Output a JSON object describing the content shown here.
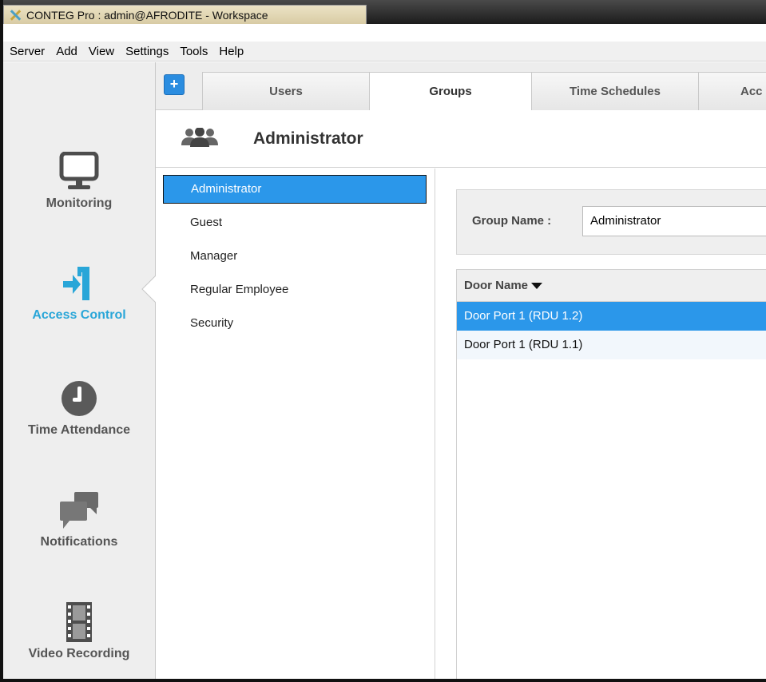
{
  "window": {
    "title": "CONTEG Pro : admin@AFRODITE - Workspace"
  },
  "menu": [
    "Server",
    "Add",
    "View",
    "Settings",
    "Tools",
    "Help"
  ],
  "sidebar": {
    "items": [
      {
        "label": "Monitoring",
        "icon": "monitor-icon",
        "active": false
      },
      {
        "label": "Access Control",
        "icon": "access-control-icon",
        "active": true
      },
      {
        "label": "Time Attendance",
        "icon": "clock-icon",
        "active": false
      },
      {
        "label": "Notifications",
        "icon": "chat-bubbles-icon",
        "active": false
      },
      {
        "label": "Video Recording",
        "icon": "film-icon",
        "active": false
      }
    ]
  },
  "toolbar": {
    "add_label": "+"
  },
  "tabs": [
    {
      "label": "Users",
      "active": false
    },
    {
      "label": "Groups",
      "active": true
    },
    {
      "label": "Time Schedules",
      "active": false
    },
    {
      "label": "Acc",
      "active": false
    }
  ],
  "header": {
    "title": "Administrator",
    "icon": "user-group-icon"
  },
  "groups": {
    "items": [
      "Administrator",
      "Guest",
      "Manager",
      "Regular Employee",
      "Security"
    ],
    "selected_index": 0
  },
  "detail": {
    "group_name_label": "Group Name :",
    "group_name_value": "Administrator",
    "door_column_header": "Door Name",
    "doors": [
      "Door Port 1 (RDU 1.2)",
      "Door Port 1 (RDU 1.1)"
    ],
    "selected_door_index": 0
  },
  "colors": {
    "accent": "#2b97ea",
    "active_nav": "#29a6d8"
  }
}
